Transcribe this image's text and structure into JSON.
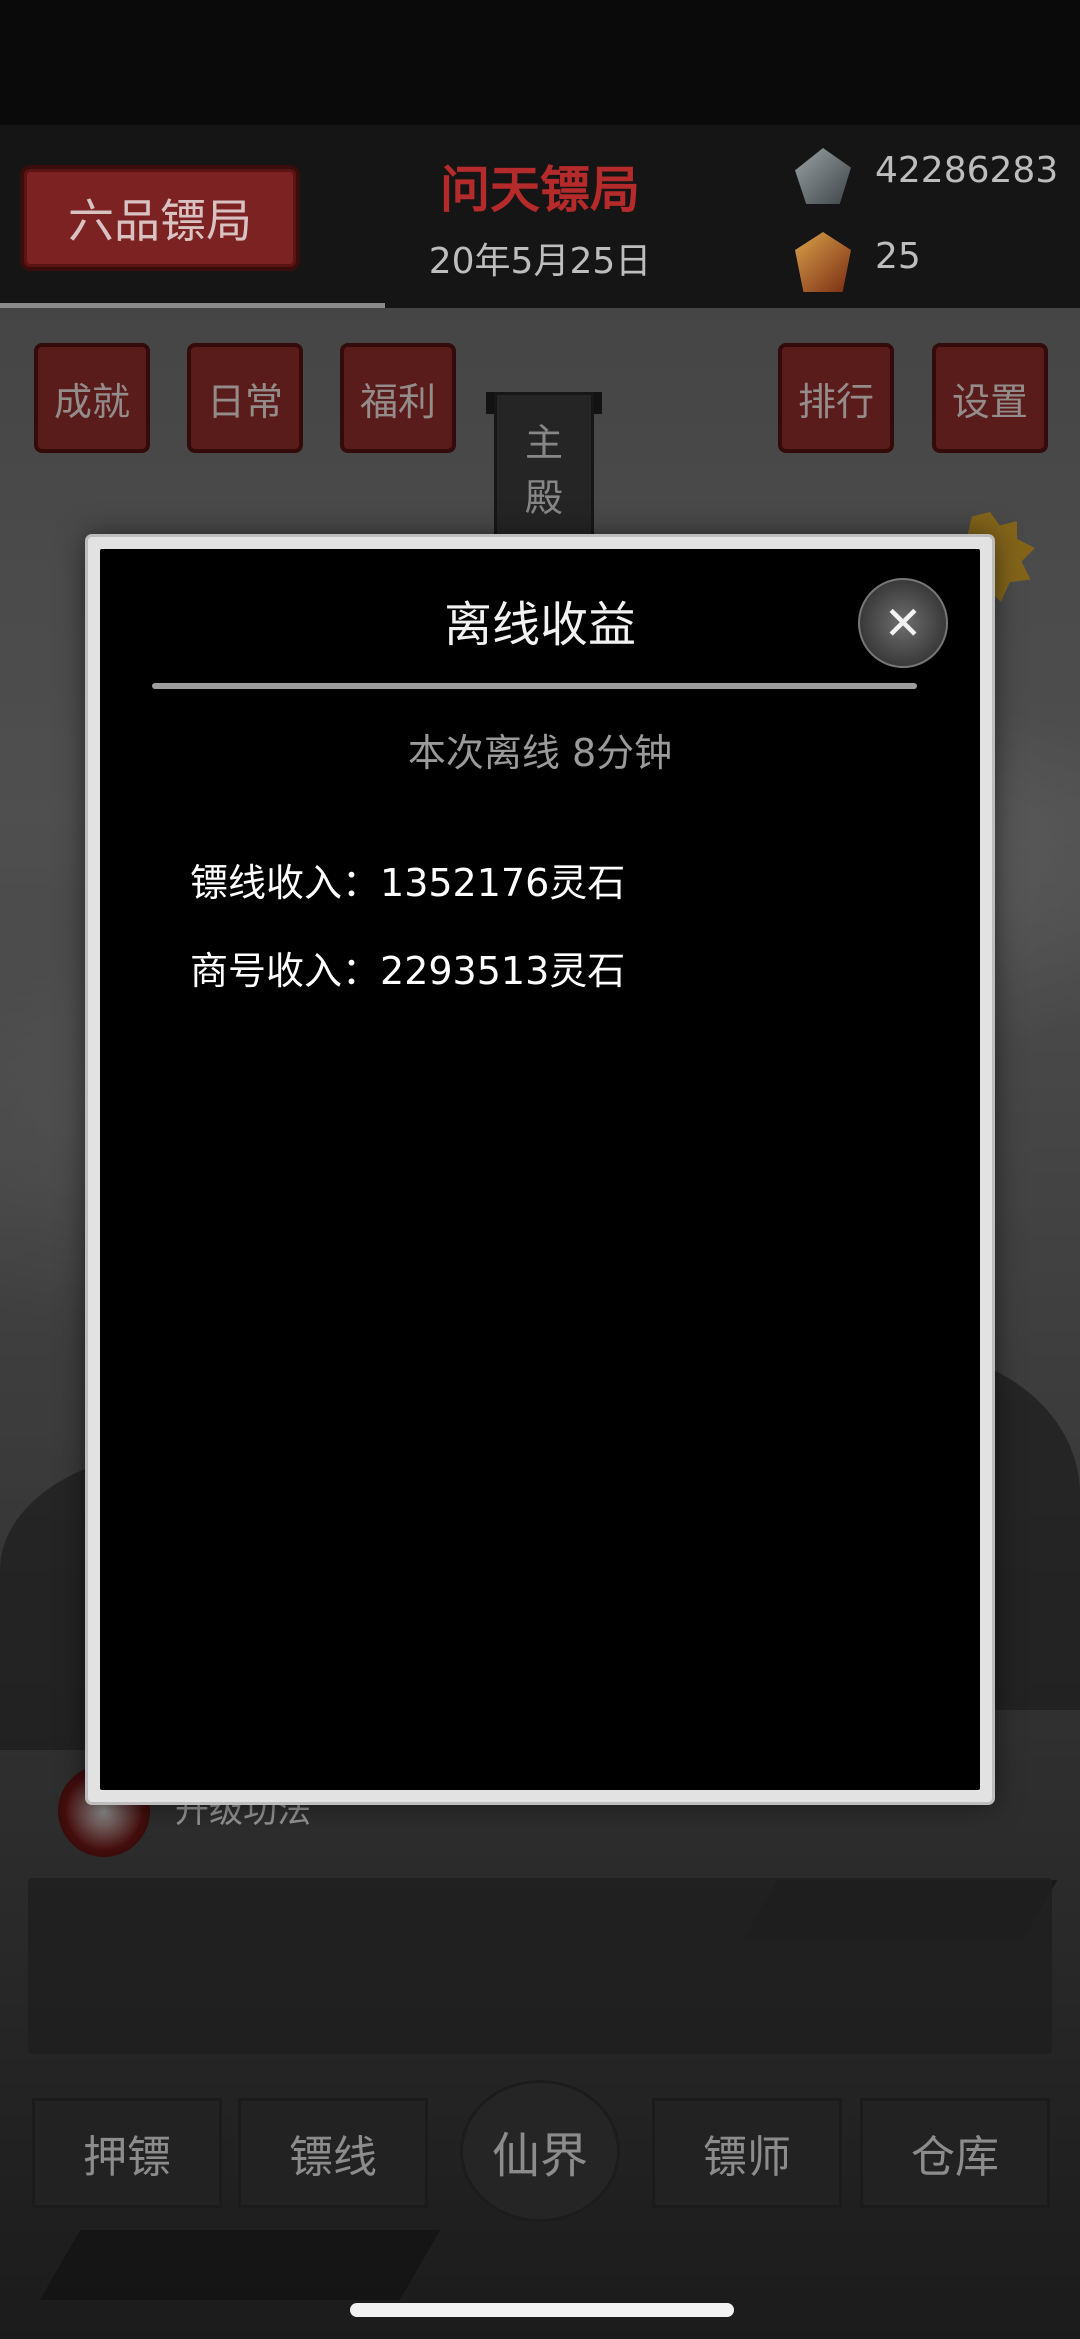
{
  "header": {
    "rank_badge": "六品镖局",
    "bureau_name": "问天镖局",
    "date": "20年5月25日",
    "resources": {
      "stone_amount": "42286283",
      "gem_amount": "25"
    }
  },
  "top_buttons": [
    "成就",
    "日常",
    "福利",
    "排行",
    "设置"
  ],
  "hall_label": [
    "主",
    "殿"
  ],
  "task_text": "升级功法",
  "bottom_nav": {
    "items": [
      "押镖",
      "镖线",
      "仙界",
      "镖师",
      "仓库"
    ]
  },
  "modal": {
    "title": "离线收益",
    "offline_time": "本次离线 8分钟",
    "lines": [
      {
        "label": "镖线收入：",
        "value": "1352176灵石"
      },
      {
        "label": "商号收入：",
        "value": "2293513灵石"
      }
    ]
  },
  "colors": {
    "bureau_name": "#b52a2a",
    "rank_badge_bg": "#7c2222",
    "button_bg": "#8a2a2a",
    "modal_bg": "#000000",
    "modal_border": "#e2e2e2"
  },
  "icons": {
    "stone": "spirit-stone-icon",
    "gem": "gem-icon",
    "close": "close-icon"
  }
}
